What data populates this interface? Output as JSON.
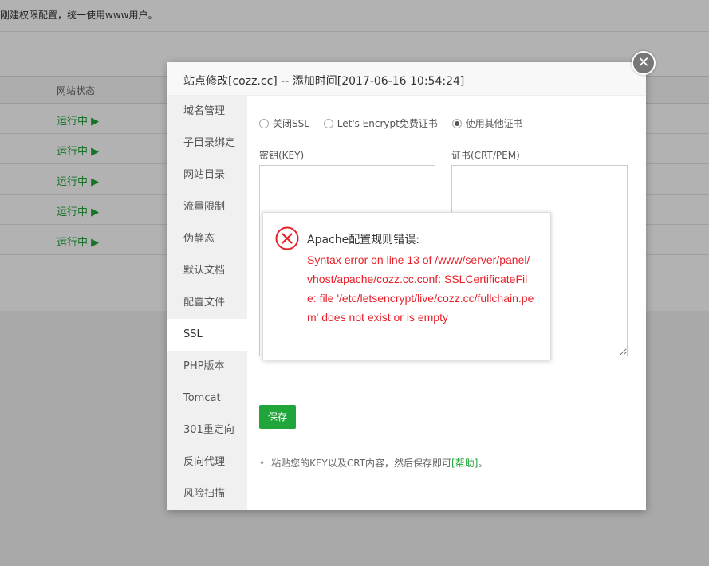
{
  "background": {
    "notice": "刚建权限配置，统一使用www用户。",
    "column_header": "网站状态",
    "rows": [
      {
        "status": "运行中 ▶"
      },
      {
        "status": "运行中 ▶"
      },
      {
        "status": "运行中 ▶"
      },
      {
        "status": "运行中 ▶"
      },
      {
        "status": "运行中 ▶"
      }
    ]
  },
  "dialog": {
    "title": "站点修改[cozz.cc] -- 添加时间[2017-06-16 10:54:24]",
    "close_glyph": "✕",
    "nav": [
      {
        "label": "域名管理"
      },
      {
        "label": "子目录绑定"
      },
      {
        "label": "网站目录"
      },
      {
        "label": "流量限制"
      },
      {
        "label": "伪静态"
      },
      {
        "label": "默认文档"
      },
      {
        "label": "配置文件"
      },
      {
        "label": "SSL"
      },
      {
        "label": "PHP版本"
      },
      {
        "label": "Tomcat"
      },
      {
        "label": "301重定向"
      },
      {
        "label": "反向代理"
      },
      {
        "label": "风险扫描"
      }
    ],
    "active_nav": "SSL",
    "ssl": {
      "options": [
        {
          "label": "关闭SSL",
          "checked": false
        },
        {
          "label": "Let's Encrypt免费证书",
          "checked": false
        },
        {
          "label": "使用其他证书",
          "checked": true
        }
      ],
      "key_label": "密钥(KEY)",
      "cert_label": "证书(CRT/PEM)",
      "key_value": "",
      "cert_value": "",
      "save_label": "保存",
      "help_text": "粘贴您的KEY以及CRT内容，然后保存即可",
      "help_link": "[帮助]",
      "help_suffix": "。"
    }
  },
  "error": {
    "title": "Apache配置规则错误:",
    "message": "Syntax error on line 13 of /www/server/panel/vhost/apache/cozz.cc.conf: SSLCertificateFile: file '/etc/letsencrypt/live/cozz.cc/fullchain.pem' does not exist or is empty"
  },
  "colors": {
    "accent_green": "#20a53a",
    "error_red": "#e8202a"
  }
}
